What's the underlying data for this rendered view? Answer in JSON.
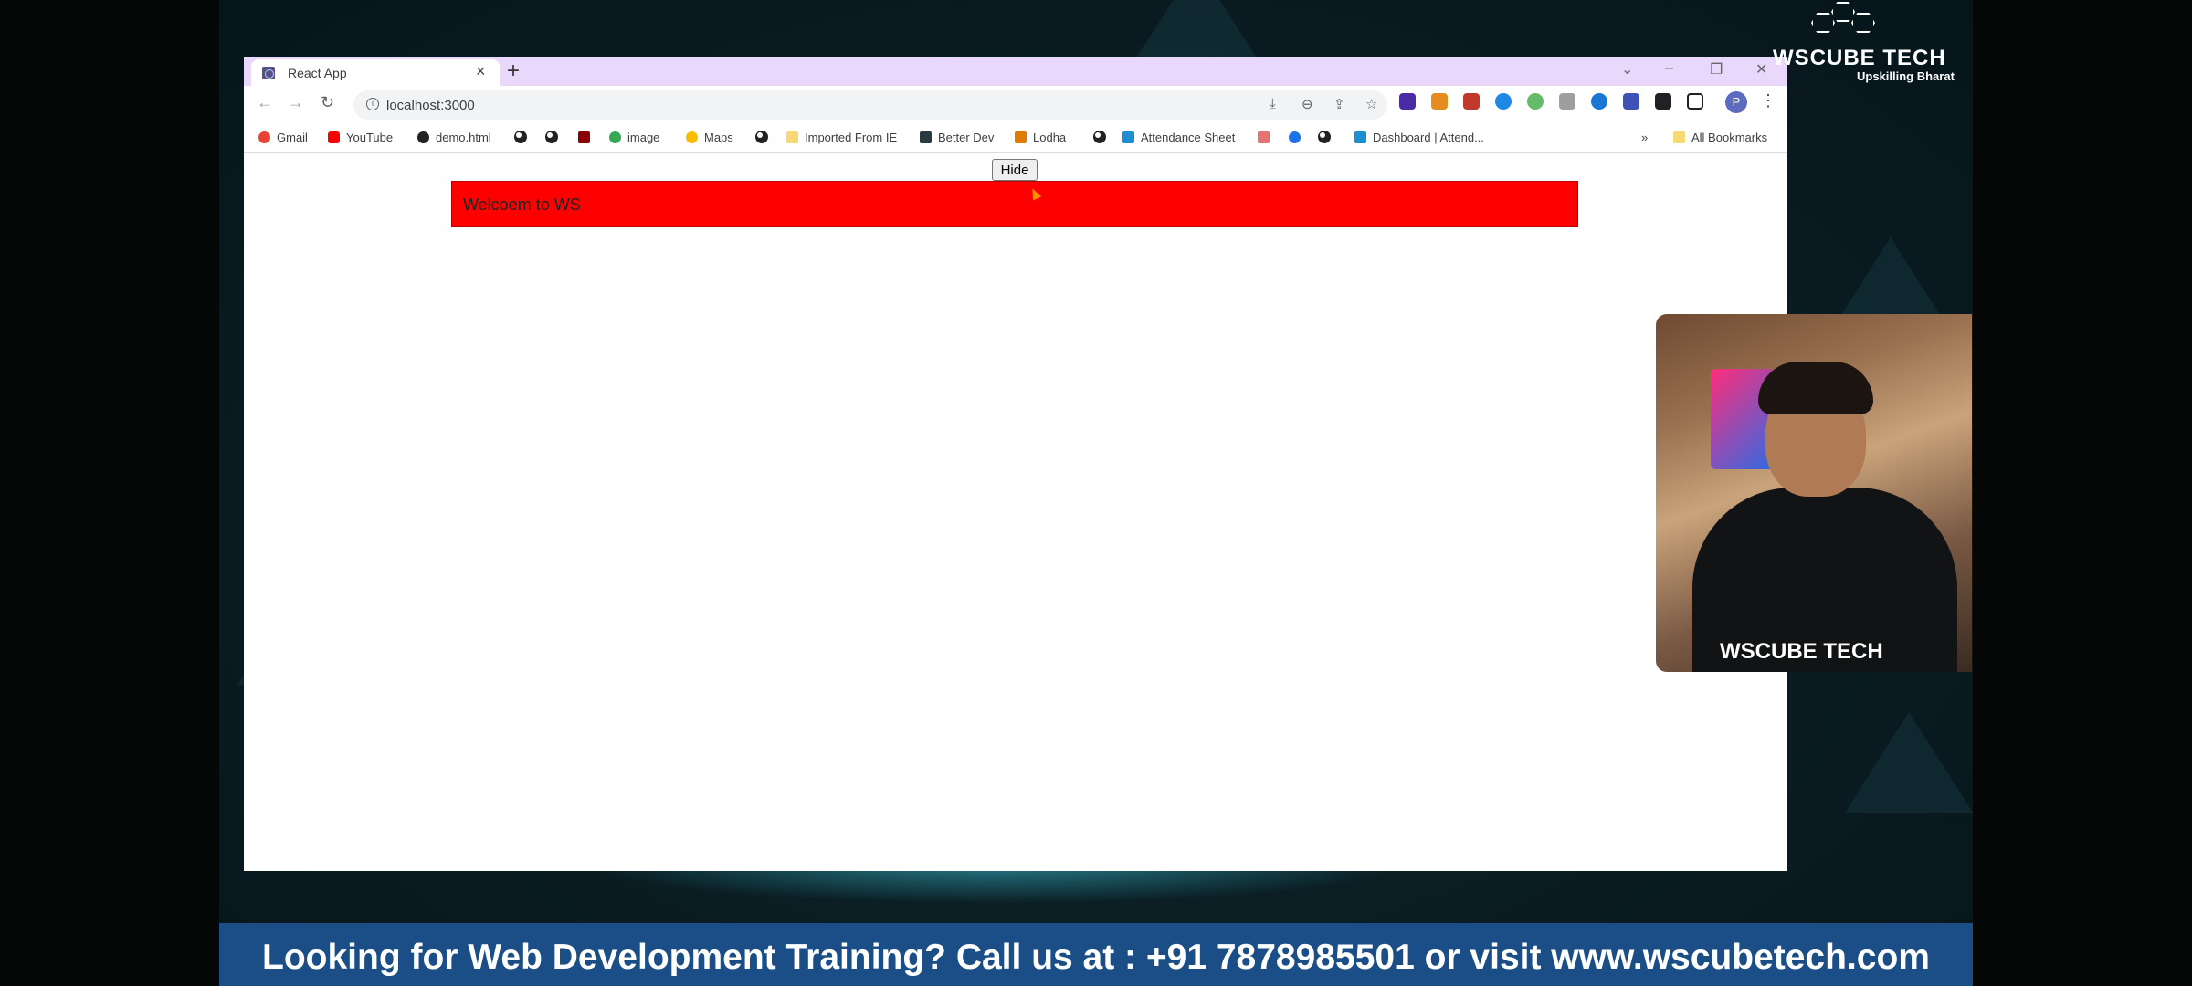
{
  "browser": {
    "tab_title": "React App",
    "tab_close": "×",
    "new_tab": "+",
    "url": "localhost:3000",
    "profile_initial": "P",
    "window_controls": {
      "minimize": "–",
      "restore": "❐",
      "close": "✕",
      "tab_search": "⌄"
    }
  },
  "bookmarks": {
    "items": [
      {
        "label": "Gmail",
        "color": "#ea4335"
      },
      {
        "label": "YouTube",
        "color": "#ff0000"
      },
      {
        "label": "demo.html",
        "color": "#222222"
      },
      {
        "label": "image",
        "color": "#34a853"
      },
      {
        "label": "Maps",
        "color": "#fbbc04"
      },
      {
        "label": "Imported From IE",
        "color": "#f8d775"
      },
      {
        "label": "Better Dev",
        "color": "#2b3a42"
      },
      {
        "label": "Lodha",
        "color": "#e07b00"
      },
      {
        "label": "Attendance Sheet",
        "color": "#1b8fd1"
      },
      {
        "label": "Dashboard | Attend...",
        "color": "#1b8fd1"
      }
    ],
    "overflow": "»",
    "all_bookmarks": "All Bookmarks"
  },
  "page": {
    "hide_button": "Hide",
    "welcome_text": "Welcoem to WS",
    "welcome_bg": "#ff0000"
  },
  "logo": {
    "title": "WSCUBE TECH",
    "tagline": "Upskilling Bharat"
  },
  "webcam": {
    "shirt_logo": "WSCUBE TECH"
  },
  "banner": {
    "text": "Looking for Web Development Training? Call us at : +91 7878985501 or visit www.wscubetech.com"
  }
}
